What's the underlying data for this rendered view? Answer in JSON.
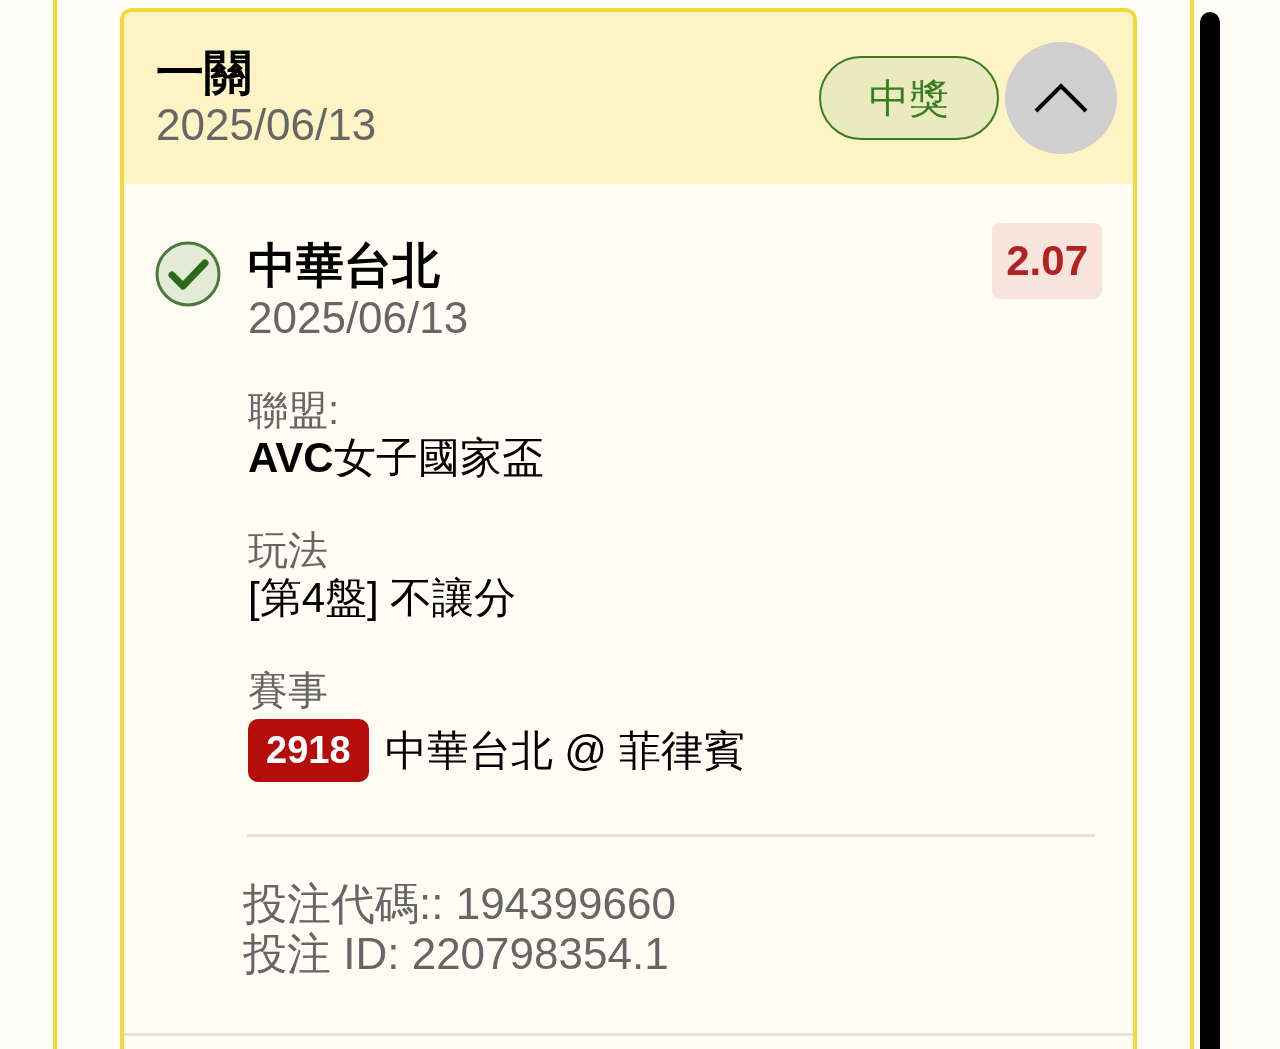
{
  "parlay": {
    "title": "一關",
    "date": "2025/06/13",
    "status": "中獎",
    "expanded": true
  },
  "bet": {
    "checked": true,
    "team": "中華台北",
    "date": "2025/06/13",
    "odds": "2.07",
    "fields": [
      {
        "label": "聯盟:",
        "value": "**AVC**女子國家盃"
      },
      {
        "label": "玩法",
        "value": "[第4盤] 不讓分"
      }
    ],
    "event": {
      "label": "賽事",
      "number": "2918",
      "matchup": "中華台北 @ 菲律賓"
    },
    "code": "投注代碼:: 194399660",
    "bet_id": "投注 ID: 220798354.1"
  }
}
